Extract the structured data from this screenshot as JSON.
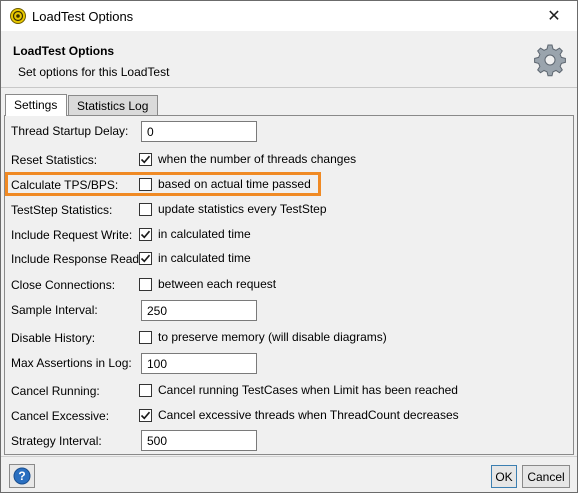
{
  "window": {
    "title": "LoadTest Options",
    "close_glyph": "✕"
  },
  "header": {
    "title": "LoadTest Options",
    "subtitle": "Set options for this LoadTest",
    "icon": "gear-icon"
  },
  "tabs": [
    {
      "label": "Settings",
      "active": true
    },
    {
      "label": "Statistics Log",
      "active": false
    }
  ],
  "settings": {
    "thread_startup_delay": {
      "label": "Thread Startup Delay:",
      "value": "0"
    },
    "reset_statistics": {
      "label": "Reset Statistics:",
      "checked": true,
      "text": "when the number of threads changes"
    },
    "calculate_tps": {
      "label": "Calculate TPS/BPS:",
      "checked": false,
      "text": "based on actual time passed"
    },
    "teststep_statistics": {
      "label": "TestStep Statistics:",
      "checked": false,
      "text": "update statistics every TestStep"
    },
    "include_request_write": {
      "label": "Include Request Write:",
      "checked": true,
      "text": "in calculated time"
    },
    "include_response_read": {
      "label": "Include Response Read:",
      "checked": true,
      "text": "in calculated time"
    },
    "close_connections": {
      "label": "Close Connections:",
      "checked": false,
      "text": "between each request"
    },
    "sample_interval": {
      "label": "Sample Interval:",
      "value": "250"
    },
    "disable_history": {
      "label": "Disable History:",
      "checked": false,
      "text": "to preserve memory (will disable diagrams)"
    },
    "max_assertions": {
      "label": "Max Assertions in Log:",
      "value": "100"
    },
    "cancel_running": {
      "label": "Cancel Running:",
      "checked": false,
      "text": "Cancel running TestCases when Limit has been reached"
    },
    "cancel_excessive": {
      "label": "Cancel Excessive:",
      "checked": true,
      "text": "Cancel excessive threads when ThreadCount decreases"
    },
    "strategy_interval": {
      "label": "Strategy Interval:",
      "value": "500"
    }
  },
  "footer": {
    "ok_label": "OK",
    "cancel_label": "Cancel",
    "help_icon": "help-icon"
  },
  "colors": {
    "highlight": "#f08a24",
    "checkmark": "#1a1a1a",
    "help_blue": "#2a6fc0"
  }
}
